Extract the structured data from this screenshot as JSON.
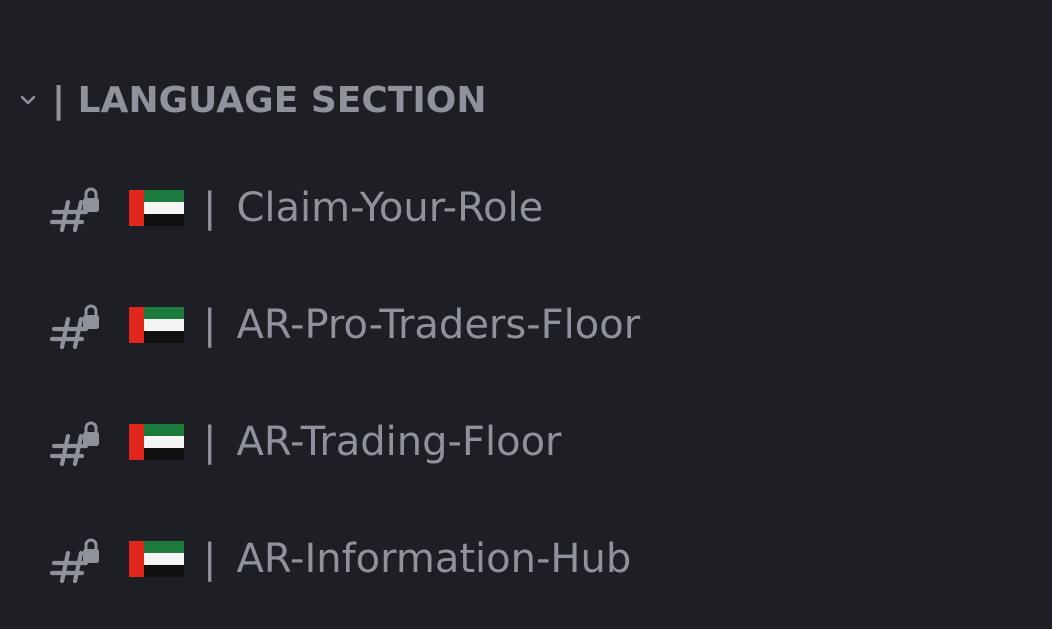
{
  "category": {
    "label": "| LANGUAGE SECTION",
    "icon": "chevron-down-icon",
    "expanded": true
  },
  "channels": [
    {
      "separator": "|",
      "name": "Claim-Your-Role",
      "flag": "uae-flag",
      "icon": "locked-text-channel-icon"
    },
    {
      "separator": "|",
      "name": "AR-Pro-Traders-Floor",
      "flag": "uae-flag",
      "icon": "locked-text-channel-icon"
    },
    {
      "separator": "|",
      "name": "AR-Trading-Floor",
      "flag": "uae-flag",
      "icon": "locked-text-channel-icon"
    },
    {
      "separator": "|",
      "name": "AR-Information-Hub",
      "flag": "uae-flag",
      "icon": "locked-text-channel-icon"
    }
  ],
  "colors": {
    "background": "#1e1f24",
    "text_muted": "#8f929b",
    "flag_red": "#e1261c",
    "flag_green": "#1b7a3c",
    "flag_white": "#f4f4f4",
    "flag_black": "#111111"
  }
}
